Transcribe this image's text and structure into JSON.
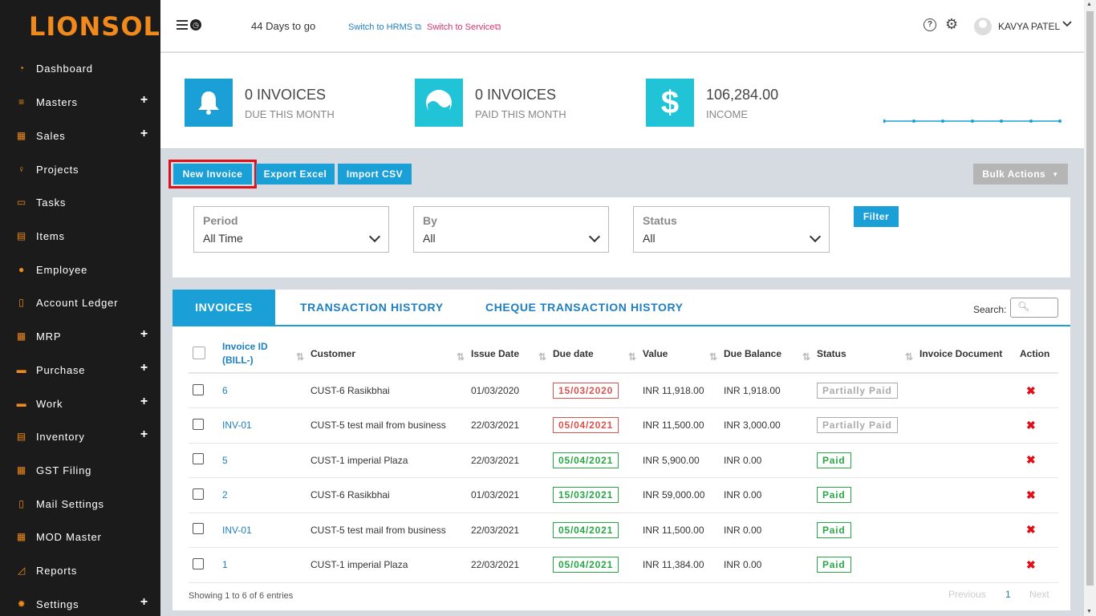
{
  "brand": {
    "logo_text": "LIONSOL"
  },
  "sidebar": {
    "items": [
      {
        "label": "Dashboard",
        "icon": "dashboard-icon",
        "glyph": "◔",
        "expand": ""
      },
      {
        "label": "Masters",
        "icon": "database-icon",
        "glyph": "≡",
        "expand": "+"
      },
      {
        "label": "Sales",
        "icon": "sales-chart-icon",
        "glyph": "▦",
        "expand": "+"
      },
      {
        "label": "Projects",
        "icon": "lightbulb-icon",
        "glyph": "♀",
        "expand": ""
      },
      {
        "label": "Tasks",
        "icon": "inbox-icon",
        "glyph": "▭",
        "expand": ""
      },
      {
        "label": "Items",
        "icon": "archive-icon",
        "glyph": "▤",
        "expand": ""
      },
      {
        "label": "Employee",
        "icon": "user-icon",
        "glyph": "●",
        "expand": ""
      },
      {
        "label": "Account Ledger",
        "icon": "document-icon",
        "glyph": "▯",
        "expand": ""
      },
      {
        "label": "MRP",
        "icon": "grid-icon",
        "glyph": "▦",
        "expand": "+"
      },
      {
        "label": "Purchase",
        "icon": "briefcase-icon",
        "glyph": "▬",
        "expand": "+"
      },
      {
        "label": "Work",
        "icon": "briefcase-icon",
        "glyph": "▬",
        "expand": "+"
      },
      {
        "label": "Inventory",
        "icon": "archive-icon",
        "glyph": "▤",
        "expand": "+"
      },
      {
        "label": "GST Filing",
        "icon": "calendar-icon",
        "glyph": "▦",
        "expand": ""
      },
      {
        "label": "Mail Settings",
        "icon": "document-icon",
        "glyph": "▯",
        "expand": ""
      },
      {
        "label": "MOD Master",
        "icon": "grid-icon",
        "glyph": "▦",
        "expand": ""
      },
      {
        "label": "Reports",
        "icon": "area-chart-icon",
        "glyph": "◿",
        "expand": ""
      },
      {
        "label": "Settings",
        "icon": "gear-icon",
        "glyph": "✹",
        "expand": "+"
      }
    ]
  },
  "topbar": {
    "days_to_go": "44 Days to go",
    "switch_hrms": "Switch to HRMS",
    "switch_service": "Switch to Service",
    "user_name": "KAVYA PATEL",
    "help_glyph": "?",
    "gear_glyph": "⚙",
    "chevron_glyph": "⌄"
  },
  "stats": {
    "due": {
      "value": "0 INVOICES",
      "label": "DUE THIS MONTH",
      "color": "#1a9fd6"
    },
    "paid": {
      "value": "0 INVOICES",
      "label": "PAID THIS MONTH",
      "color": "#20c4d6"
    },
    "income": {
      "value": "106,284.00",
      "label": "INCOME",
      "color": "#20c4d6",
      "glyph": "$"
    }
  },
  "actions": {
    "new_invoice": "New Invoice",
    "export_excel": "Export Excel",
    "import_csv": "Import CSV",
    "bulk_actions": "Bulk Actions"
  },
  "filters": {
    "period": {
      "label": "Period",
      "value": "All Time"
    },
    "by": {
      "label": "By",
      "value": "All"
    },
    "status": {
      "label": "Status",
      "value": "All"
    },
    "filter_btn": "Filter"
  },
  "tabs": [
    "INVOICES",
    "TRANSACTION HISTORY",
    "CHEQUE TRANSACTION HISTORY"
  ],
  "search_label": "Search:",
  "table": {
    "headers": {
      "invoice_id_1": "Invoice ID",
      "invoice_id_2": "(BILL-)",
      "customer": "Customer",
      "issue_date": "Issue Date",
      "due_date": "Due date",
      "value": "Value",
      "due_balance": "Due Balance",
      "status": "Status",
      "invoice_document": "Invoice Document",
      "action": "Action"
    },
    "rows": [
      {
        "id": "6",
        "customer": "CUST-6 Rasikbhai",
        "issue": "01/03/2020",
        "due": "15/03/2020",
        "due_style": "red",
        "value": "INR 11,918.00",
        "balance": "INR 1,918.00",
        "status": "Partially Paid",
        "status_style": "pp"
      },
      {
        "id": "INV-01",
        "customer": "CUST-5 test mail from business",
        "issue": "22/03/2021",
        "due": "05/04/2021",
        "due_style": "red",
        "value": "INR 11,500.00",
        "balance": "INR 3,000.00",
        "status": "Partially Paid",
        "status_style": "pp"
      },
      {
        "id": "5",
        "customer": "CUST-1 imperial Plaza",
        "issue": "22/03/2021",
        "due": "05/04/2021",
        "due_style": "green",
        "value": "INR 5,900.00",
        "balance": "INR 0.00",
        "status": "Paid",
        "status_style": "paid"
      },
      {
        "id": "2",
        "customer": "CUST-6 Rasikbhai",
        "issue": "01/03/2021",
        "due": "15/03/2021",
        "due_style": "green",
        "value": "INR 59,000.00",
        "balance": "INR 0.00",
        "status": "Paid",
        "status_style": "paid"
      },
      {
        "id": "INV-01",
        "customer": "CUST-5 test mail from business",
        "issue": "22/03/2021",
        "due": "05/04/2021",
        "due_style": "green",
        "value": "INR 11,500.00",
        "balance": "INR 0.00",
        "status": "Paid",
        "status_style": "paid"
      },
      {
        "id": "1",
        "customer": "CUST-1 imperial Plaza",
        "issue": "22/03/2021",
        "due": "05/04/2021",
        "due_style": "green",
        "value": "INR 11,384.00",
        "balance": "INR 0.00",
        "status": "Paid",
        "status_style": "paid"
      }
    ]
  },
  "pagination": {
    "showing": "Showing 1 to 6 of 6 entries",
    "previous": "Previous",
    "page": "1",
    "next": "Next"
  }
}
